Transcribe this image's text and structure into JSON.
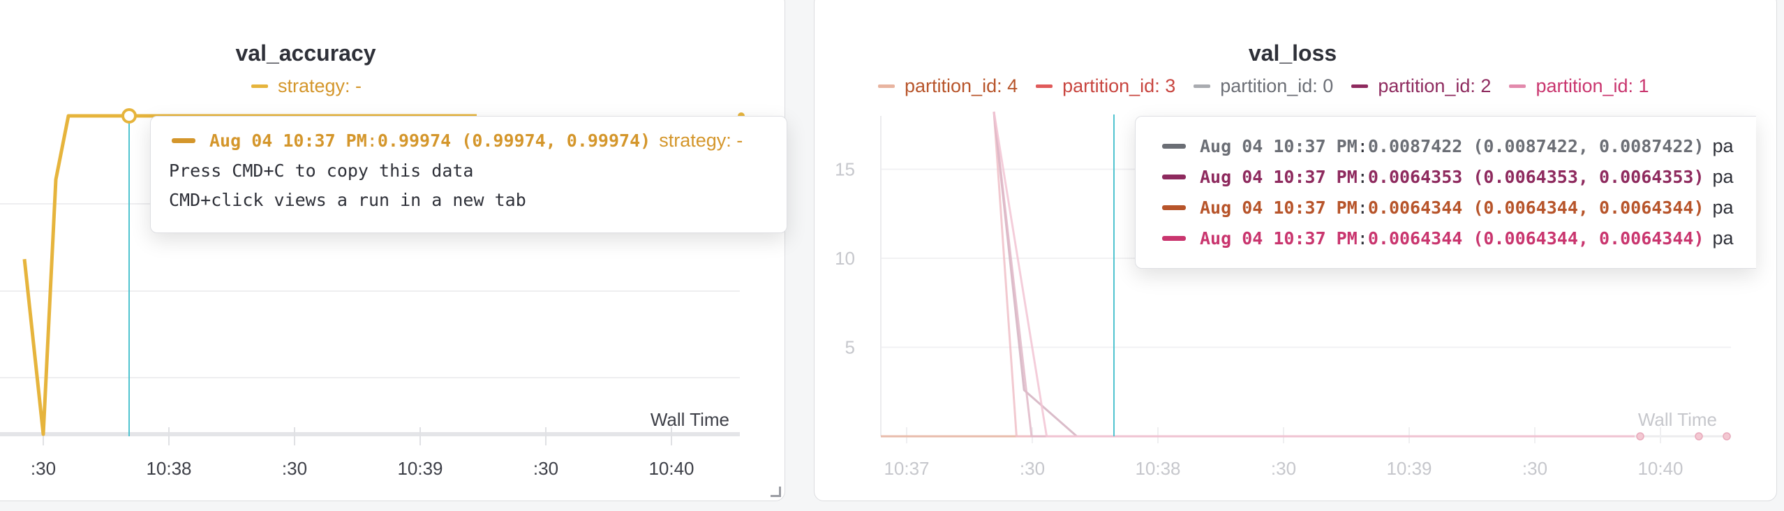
{
  "left_panel": {
    "title": "val_accuracy",
    "legend": [
      {
        "label": "strategy: -",
        "color": "#e6b43c"
      }
    ],
    "x_axis_label": "Wall Time",
    "tooltip": {
      "row": {
        "time": "Aug 04 10:37 PM",
        "value": "0.99974",
        "range": "(0.99974, 0.99974)",
        "run": "strategy: -",
        "color": "#d4962b"
      },
      "hint_copy": "Press CMD+C to copy this data",
      "hint_click": "CMD+click views a run in a new tab"
    }
  },
  "right_panel": {
    "title": "val_loss",
    "legend": [
      {
        "label": "partition_id: 4",
        "color": "#e8b4a0",
        "text_color": "#b7542a"
      },
      {
        "label": "partition_id: 3",
        "color": "#e05a5a",
        "text_color": "#c8453f"
      },
      {
        "label": "partition_id: 0",
        "color": "#a9abb0",
        "text_color": "#6b6e75"
      },
      {
        "label": "partition_id: 2",
        "color": "#8e2a5e",
        "text_color": "#8e2a5e"
      },
      {
        "label": "partition_id: 1",
        "color": "#e28aac",
        "text_color": "#c9356e"
      }
    ],
    "x_axis_label": "Wall Time",
    "tooltip": {
      "rows": [
        {
          "time": "Aug 04 10:37 PM",
          "value": "0.0087422",
          "range": "(0.0087422, 0.0087422)",
          "run": "pa",
          "color": "#6b6e75"
        },
        {
          "time": "Aug 04 10:37 PM",
          "value": "0.0064353",
          "range": "(0.0064353, 0.0064353)",
          "run": "pa",
          "color": "#8e2a5e"
        },
        {
          "time": "Aug 04 10:37 PM",
          "value": "0.0064344",
          "range": "(0.0064344, 0.0064344)",
          "run": "pa",
          "color": "#b7542a"
        },
        {
          "time": "Aug 04 10:37 PM",
          "value": "0.0064344",
          "range": "(0.0064344, 0.0064344)",
          "run": "pa",
          "color": "#c9356e"
        }
      ]
    }
  },
  "chart_data": [
    {
      "type": "line",
      "title": "val_accuracy",
      "xlabel": "Wall Time",
      "x_ticks": [
        ":30",
        "10:38",
        ":30",
        "10:39",
        ":30",
        "10:40"
      ],
      "grid": true,
      "series": [
        {
          "name": "strategy: -",
          "color": "#e6b43c",
          "points": [
            [
              -0.06,
              0.55
            ],
            [
              0.0,
              0.0
            ],
            [
              0.04,
              0.8
            ],
            [
              0.08,
              1.0
            ],
            [
              1.38,
              1.0
            ]
          ]
        }
      ]
    },
    {
      "type": "line",
      "title": "val_loss",
      "xlabel": "Wall Time",
      "x_ticks": [
        "10:37",
        ":30",
        "10:38",
        ":30",
        "10:39",
        ":30",
        "10:40"
      ],
      "y_ticks": [
        "5",
        "10",
        "15"
      ],
      "ylim": [
        0,
        18
      ],
      "grid": true,
      "series": [
        {
          "name": "partition_id: 4",
          "color": "#e8b4a0",
          "points": [
            [
              0.0,
              0.0
            ],
            [
              0.38,
              0.0
            ],
            [
              0.54,
              0.0
            ],
            [
              3.0,
              0.0
            ]
          ]
        },
        {
          "name": "partition_id: 3",
          "color": "#f0c0c8",
          "points": [
            [
              0.45,
              25
            ],
            [
              0.54,
              0.0
            ],
            [
              3.0,
              0.0
            ]
          ]
        },
        {
          "name": "partition_id: 0",
          "color": "#d4b0c0",
          "points": [
            [
              0.45,
              25
            ],
            [
              0.57,
              2.6
            ],
            [
              0.78,
              0.0
            ],
            [
              3.0,
              0.0
            ]
          ]
        },
        {
          "name": "partition_id: 2",
          "color": "#e0b8c8",
          "points": [
            [
              0.45,
              25
            ],
            [
              0.6,
              0.0
            ],
            [
              3.0,
              0.0
            ]
          ]
        },
        {
          "name": "partition_id: 1",
          "color": "#f2c4d4",
          "points": [
            [
              0.45,
              25
            ],
            [
              0.66,
              0.0
            ],
            [
              3.0,
              0.0
            ]
          ]
        }
      ]
    }
  ]
}
